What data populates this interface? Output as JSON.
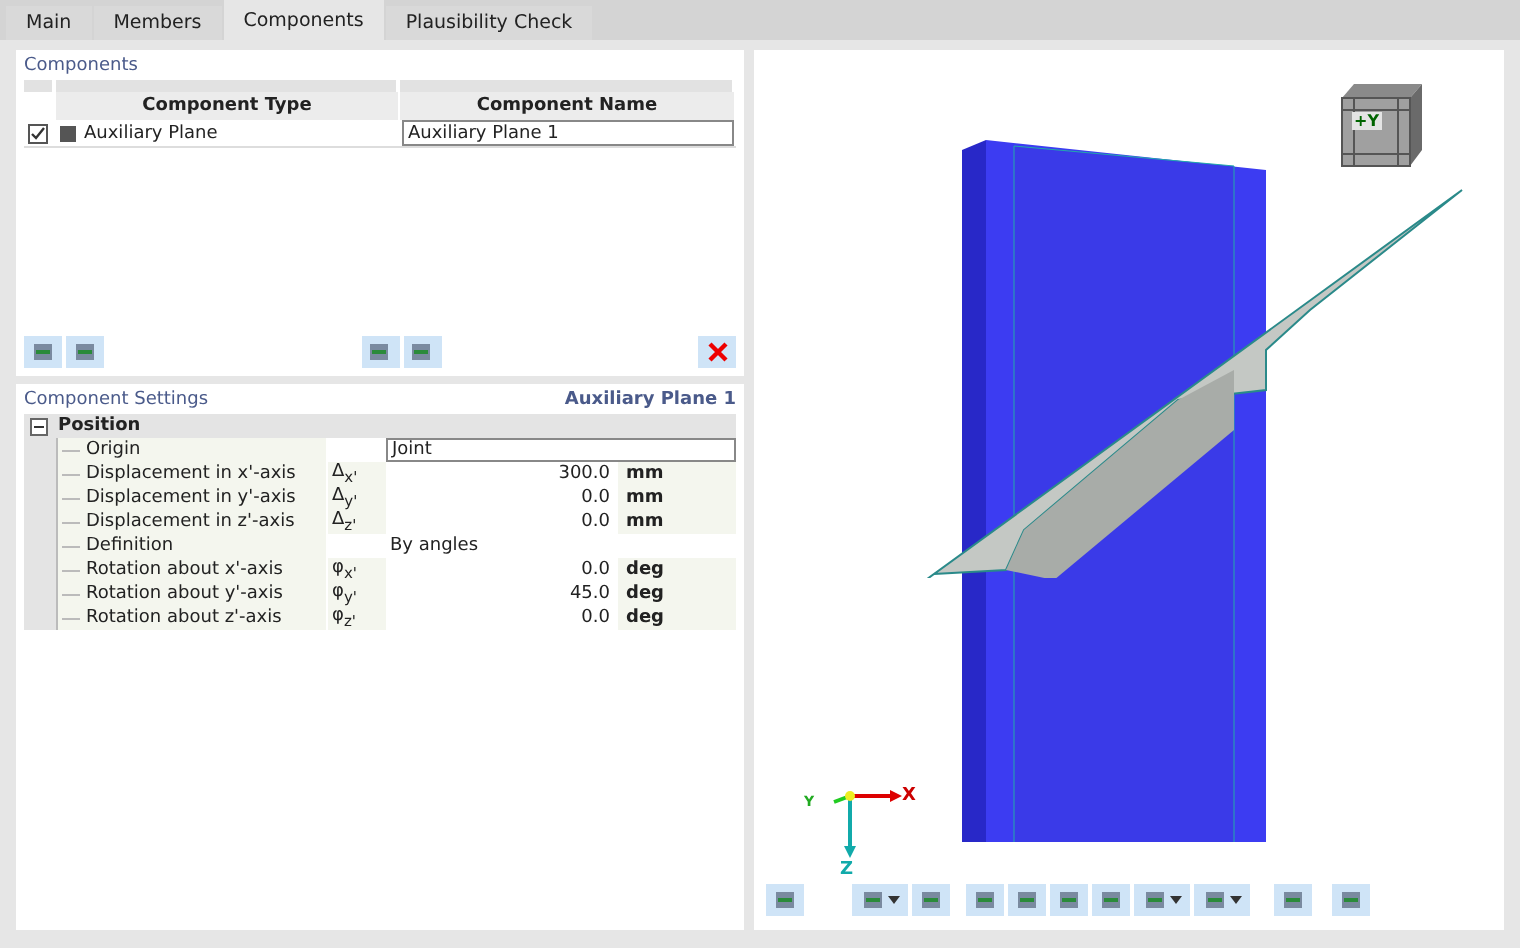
{
  "tabs": [
    {
      "label": "Main",
      "selected": false
    },
    {
      "label": "Members",
      "selected": false
    },
    {
      "label": "Components",
      "selected": true
    },
    {
      "label": "Plausibility Check",
      "selected": false
    }
  ],
  "components": {
    "title": "Components",
    "columns": [
      "Component Type",
      "Component Name"
    ],
    "rows": [
      {
        "checked": true,
        "color": "#555555",
        "type": "Auxiliary Plane",
        "name": "Auxiliary Plane 1"
      }
    ]
  },
  "settings": {
    "title": "Component Settings",
    "subtitle": "Auxiliary Plane 1",
    "group": {
      "label": "Position",
      "expanded": true,
      "children": [
        {
          "kind": "field",
          "label": "Origin",
          "value": "Joint"
        },
        {
          "kind": "number",
          "label": "Displacement in x'-axis",
          "symbol": "Δ$_{x'}$",
          "value": "300.0",
          "unit": "mm"
        },
        {
          "kind": "number",
          "label": "Displacement in y'-axis",
          "symbol": "Δ$_{y'}$",
          "value": "0.0",
          "unit": "mm"
        },
        {
          "kind": "number",
          "label": "Displacement in z'-axis",
          "symbol": "Δ$_{z'}$",
          "value": "0.0",
          "unit": "mm"
        },
        {
          "kind": "text",
          "label": "Definition",
          "value": "By angles"
        },
        {
          "kind": "number",
          "label": "Rotation about x'-axis",
          "symbol": "φ$_{x'}$",
          "value": "0.0",
          "unit": "deg"
        },
        {
          "kind": "number",
          "label": "Rotation about y'-axis",
          "symbol": "φ$_{y'}$",
          "value": "45.0",
          "unit": "deg"
        },
        {
          "kind": "number",
          "label": "Rotation about z'-axis",
          "symbol": "φ$_{z'}$",
          "value": "0.0",
          "unit": "deg"
        }
      ]
    }
  },
  "viewport": {
    "cube_label": "+Y",
    "axes": {
      "x": "X",
      "y": "Y",
      "z": "Z"
    }
  }
}
